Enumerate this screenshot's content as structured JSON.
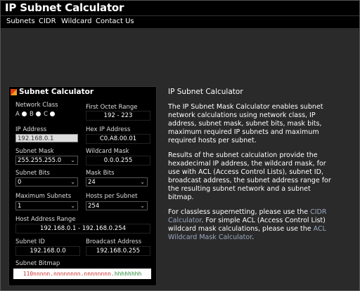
{
  "header": {
    "title": "IP Subnet Calculator"
  },
  "nav": {
    "items": [
      "Subnets",
      "CIDR",
      "Wildcard",
      "Contact Us"
    ]
  },
  "panel": {
    "title": "Subnet Calculator",
    "network_class_label": "Network Class",
    "class_a": "A",
    "class_b": "B",
    "class_c": "C",
    "first_octet_label": "First Octet Range",
    "first_octet_value": "192 - 223",
    "ip_label": "IP Address",
    "ip_value": "192.168.0.1",
    "hex_label": "Hex IP Address",
    "hex_value": "C0.A8.00.01",
    "mask_label": "Subnet Mask",
    "mask_value": "255.255.255.0",
    "wildcard_label": "Wildcard Mask",
    "wildcard_value": "0.0.0.255",
    "subnet_bits_label": "Subnet Bits",
    "subnet_bits_value": "0",
    "mask_bits_label": "Mask Bits",
    "mask_bits_value": "24",
    "max_subnets_label": "Maximum Subnets",
    "max_subnets_value": "1",
    "hosts_label": "Hosts per Subnet",
    "hosts_value": "254",
    "host_range_label": "Host Address Range",
    "host_range_value": "192.168.0.1 - 192.168.0.254",
    "subnet_id_label": "Subnet ID",
    "subnet_id_value": "192.168.0.0",
    "broadcast_label": "Broadcast Address",
    "broadcast_value": "192.168.0.255",
    "bitmap_label": "Subnet Bitmap",
    "bitmap_prefix": "110nnnnn.nnnnnnnn.nnnnnnnn.",
    "bitmap_suffix": "hhhhhhhh"
  },
  "info": {
    "heading": "IP Subnet Calculator",
    "p1": "The IP Subnet Mask Calculator enables subnet network calculations using network class, IP address, subnet mask, subnet bits, mask bits, maximum required IP subnets and maximum required hosts per subnet.",
    "p2": "Results of the subnet calculation provide the hexadecimal IP address, the wildcard mask, for use with ACL (Access Control Lists), subnet ID, broadcast address, the subnet address range for the resulting subnet network and a subnet bitmap.",
    "p3_a": "For classless supernetting, please use the ",
    "p3_link1": "CIDR Calculator",
    "p3_b": ". For simple ACL (Access Control List) wildcard mask calculations, please use the ",
    "p3_link2": "ACL Wildcard Mask Calculator",
    "p3_c": "."
  },
  "colors": {
    "bitmap_network": "#cc3333",
    "bitmap_host": "#228833",
    "link": "#9aa8c0"
  }
}
